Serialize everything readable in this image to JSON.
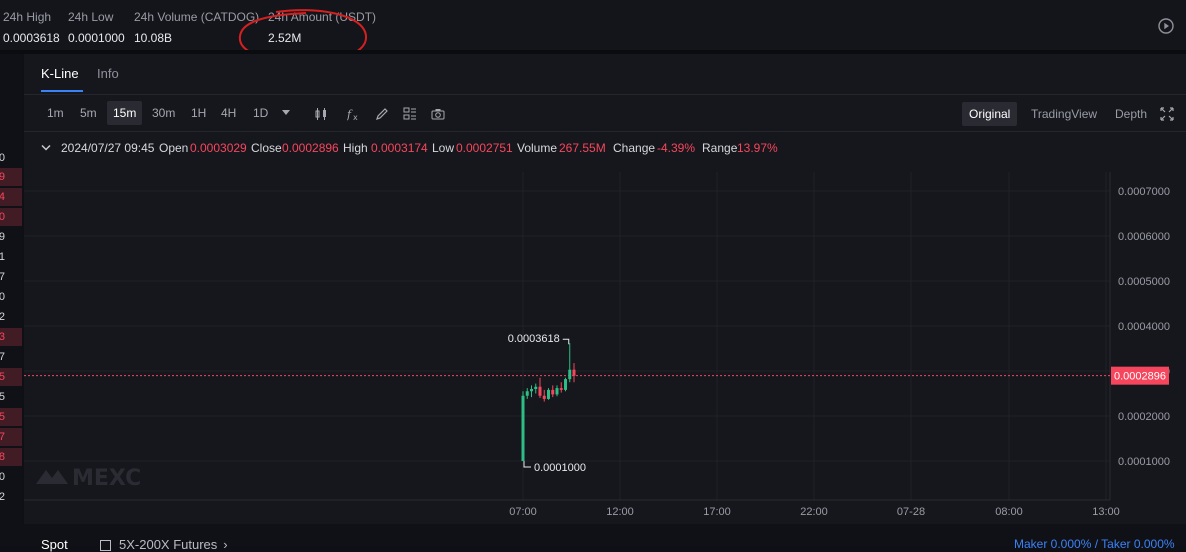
{
  "stats": [
    {
      "label": "24h High",
      "value": "0.0003618"
    },
    {
      "label": "24h Low",
      "value": "0.0001000"
    },
    {
      "label": "24h Volume (CATDOG)",
      "value": "10.08B"
    },
    {
      "label": "24h Amount (USDT)",
      "value": "2.52M"
    }
  ],
  "left_strip": [
    "0",
    "9",
    "4",
    "0",
    "9",
    "1",
    "7",
    "0",
    "2",
    "3",
    "7",
    "5",
    "5",
    "5",
    "7",
    "8",
    "0",
    "2"
  ],
  "tabs": {
    "kline": "K-Line",
    "info": "Info"
  },
  "timeframes": [
    "1m",
    "5m",
    "15m",
    "30m",
    "1H",
    "4H",
    "1D"
  ],
  "selected_timeframe": "15m",
  "views": {
    "original": "Original",
    "tradingview": "TradingView",
    "depth": "Depth"
  },
  "ohlc": {
    "date": "2024/07/27 09:45",
    "open_label": "Open",
    "open": "0.0003029",
    "close_label": "Close",
    "close": "0.0002896",
    "high_label": "High",
    "high": "0.0003174",
    "low_label": "Low",
    "low": "0.0002751",
    "volume_label": "Volume",
    "volume": "267.55M",
    "change_label": "Change",
    "change": "-4.39%",
    "range_label": "Range",
    "range": "13.97%"
  },
  "watermark": "MEXC",
  "colors": {
    "up": "#2ebd85",
    "down": "#f6465d",
    "accent": "#3b82f6",
    "annotation": "#d42020"
  },
  "chart_data": {
    "type": "candlestick",
    "y_ticks": [
      "0.0007000",
      "0.0006000",
      "0.0005000",
      "0.0004000",
      "0.0003000",
      "0.0002000",
      "0.0001000"
    ],
    "y_tick_values": [
      0.0007,
      0.0006,
      0.0005,
      0.0004,
      0.0003,
      0.0002,
      0.0001
    ],
    "x_ticks": [
      "07:00",
      "12:00",
      "17:00",
      "22:00",
      "07-28",
      "08:00",
      "13:00"
    ],
    "current_price": "0.0002896",
    "current_price_value": 0.0002896,
    "max_label": "0.0003618",
    "min_label": "0.0001000",
    "ylim": [
      0.0,
      0.00078
    ],
    "candles": [
      {
        "o": 0.0001,
        "h": 0.000255,
        "l": 0.0001,
        "c": 0.000245
      },
      {
        "o": 0.000245,
        "h": 0.000262,
        "l": 0.000238,
        "c": 0.000255
      },
      {
        "o": 0.000255,
        "h": 0.000268,
        "l": 0.000242,
        "c": 0.00026
      },
      {
        "o": 0.00026,
        "h": 0.000272,
        "l": 0.00025,
        "c": 0.000265
      },
      {
        "o": 0.000265,
        "h": 0.000285,
        "l": 0.00024,
        "c": 0.000245
      },
      {
        "o": 0.000245,
        "h": 0.000258,
        "l": 0.000232,
        "c": 0.000238
      },
      {
        "o": 0.000238,
        "h": 0.000262,
        "l": 0.000236,
        "c": 0.000258
      },
      {
        "o": 0.000258,
        "h": 0.000268,
        "l": 0.000242,
        "c": 0.000248
      },
      {
        "o": 0.000248,
        "h": 0.000268,
        "l": 0.000244,
        "c": 0.000262
      },
      {
        "o": 0.000262,
        "h": 0.000275,
        "l": 0.000252,
        "c": 0.000258
      },
      {
        "o": 0.000258,
        "h": 0.000285,
        "l": 0.000255,
        "c": 0.000282
      },
      {
        "o": 0.000282,
        "h": 0.0003618,
        "l": 0.000275,
        "c": 0.0003029
      },
      {
        "o": 0.0003029,
        "h": 0.0003174,
        "l": 0.0002751,
        "c": 0.0002896
      }
    ]
  },
  "bottom": {
    "spot": "Spot",
    "futures": "5X-200X Futures",
    "fee": "Maker 0.000% / Taker 0.000%"
  }
}
